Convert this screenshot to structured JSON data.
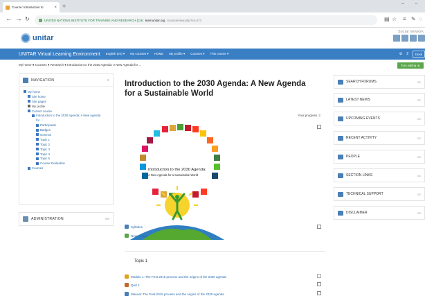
{
  "browser": {
    "tab_title": "Course: Introduction to",
    "tab_close": "×",
    "new_tab": "+",
    "url_org": "UNITED NATIONS INSTITUTE FOR TRAINING AND RESEARCH [CH]",
    "url_domain": "learnunitar.org",
    "url_path": "/course/view.php?id=474"
  },
  "site": {
    "logo_text": "unitar",
    "social_label": "Social network"
  },
  "navbar": {
    "brand": "UNITAR Virtual Learning Environment",
    "menu": [
      "English (en) ▾",
      "My courses ▾",
      "HOME",
      "My profile ▾",
      "Courses ▾",
      "This course ▾"
    ],
    "right_count": "2",
    "right_box": "Desk"
  },
  "breadcrumb": "My home ● Courses ● Research ● Introduction to the 2030 Agenda: A New Agenda for ...",
  "edit_button": "Turn editing on",
  "navigation": {
    "title": "NAVIGATION",
    "items": [
      {
        "label": "My home",
        "indent": 0,
        "dark": false
      },
      {
        "label": "Site home",
        "indent": 1,
        "dark": false
      },
      {
        "label": "Site pages",
        "indent": 1,
        "dark": false
      },
      {
        "label": "My profile",
        "indent": 1,
        "dark": true
      },
      {
        "label": "Current course",
        "indent": 1,
        "dark": false
      },
      {
        "label": "Introduction to the 2030 Agenda: A New Agenda",
        "indent": 2,
        "dark": false
      },
      {
        "label": "for ...",
        "indent": 2,
        "dark": false
      },
      {
        "label": "Participants",
        "indent": 3,
        "dark": false
      },
      {
        "label": "Badges",
        "indent": 3,
        "dark": false
      },
      {
        "label": "General",
        "indent": 3,
        "dark": false
      },
      {
        "label": "Topic 1",
        "indent": 3,
        "dark": false
      },
      {
        "label": "Topic 2",
        "indent": 3,
        "dark": false
      },
      {
        "label": "Topic 3",
        "indent": 3,
        "dark": false
      },
      {
        "label": "Topic 4",
        "indent": 3,
        "dark": false
      },
      {
        "label": "Topic 5",
        "indent": 3,
        "dark": false
      },
      {
        "label": "Course Evaluation",
        "indent": 3,
        "dark": false
      },
      {
        "label": "Courses",
        "indent": 1,
        "dark": false
      }
    ]
  },
  "administration": {
    "title": "ADMINISTRATION"
  },
  "main": {
    "course_title": "Introduction to the 2030 Agenda: A New Agenda for a Sustainable World",
    "progress_label": "Your progress ⓘ",
    "hero_title": "Introduction to the 2030 Agenda:",
    "hero_subtitle": "A New Agenda for a Sustainable World",
    "resources": [
      "Syllabus",
      "News forum"
    ],
    "topic_title": "Topic 1",
    "topic_items": [
      "Module 1: The Post 2015 process and the origins of the 2030 agenda",
      "Quiz 1",
      "Manual: The Post-2015 process and the origins of the 2030 Agenda"
    ]
  },
  "right_blocks": [
    "SEARCH FORUMS",
    "LATEST NEWS",
    "UPCOMING EVENTS",
    "RECENT ACTIVITY",
    "PEOPLE",
    "SECTION LINKS",
    "TECHNICAL SUPPORT",
    "DISCLAIMER"
  ],
  "colors": {
    "navbar": "#3a7ec4",
    "link": "#2a6aa8",
    "edit_button": "#5aa64a"
  }
}
